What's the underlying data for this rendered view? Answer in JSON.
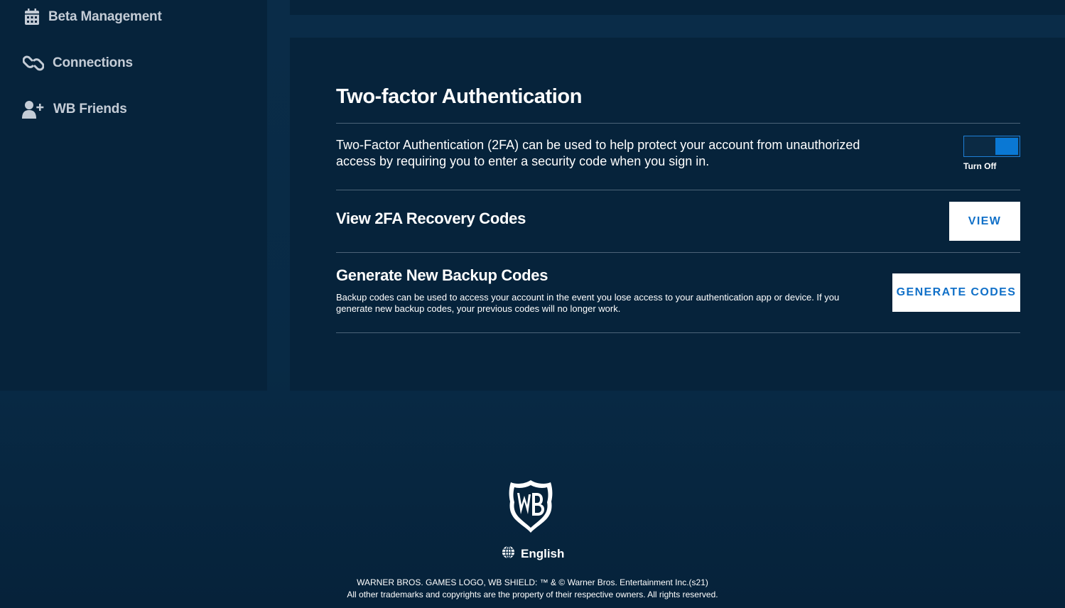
{
  "sidebar": {
    "items": [
      {
        "label": "Beta Management",
        "icon": "calendar-icon"
      },
      {
        "label": "Connections",
        "icon": "link-icon"
      },
      {
        "label": "WB Friends",
        "icon": "add-user-icon"
      }
    ]
  },
  "two_factor": {
    "title": "Two-factor Authentication",
    "description": "Two-Factor Authentication (2FA) can be used to help protect your account from unauthorized access by requiring you to enter a security code when you sign in.",
    "toggle_label": "Turn Off",
    "toggle_state": "on"
  },
  "recovery": {
    "title": "View 2FA Recovery Codes",
    "button_label": "VIEW"
  },
  "backup": {
    "title": "Generate New Backup Codes",
    "description": "Backup codes can be used to access your account in the event you lose access to your authentication app or device. If you generate new backup codes, your previous codes will no longer work.",
    "button_label": "GENERATE CODES"
  },
  "footer": {
    "language": "English",
    "legal_line1": "WARNER BROS. GAMES LOGO, WB SHIELD: ™ & © Warner Bros. Entertainment Inc.(s21)",
    "legal_line2": "All other trademarks and copyrights are the property of their respective owners. All rights reserved."
  },
  "colors": {
    "background": "#082a45",
    "card": "#06233b",
    "accent": "#0a78d4",
    "button_text": "#1070c8"
  }
}
